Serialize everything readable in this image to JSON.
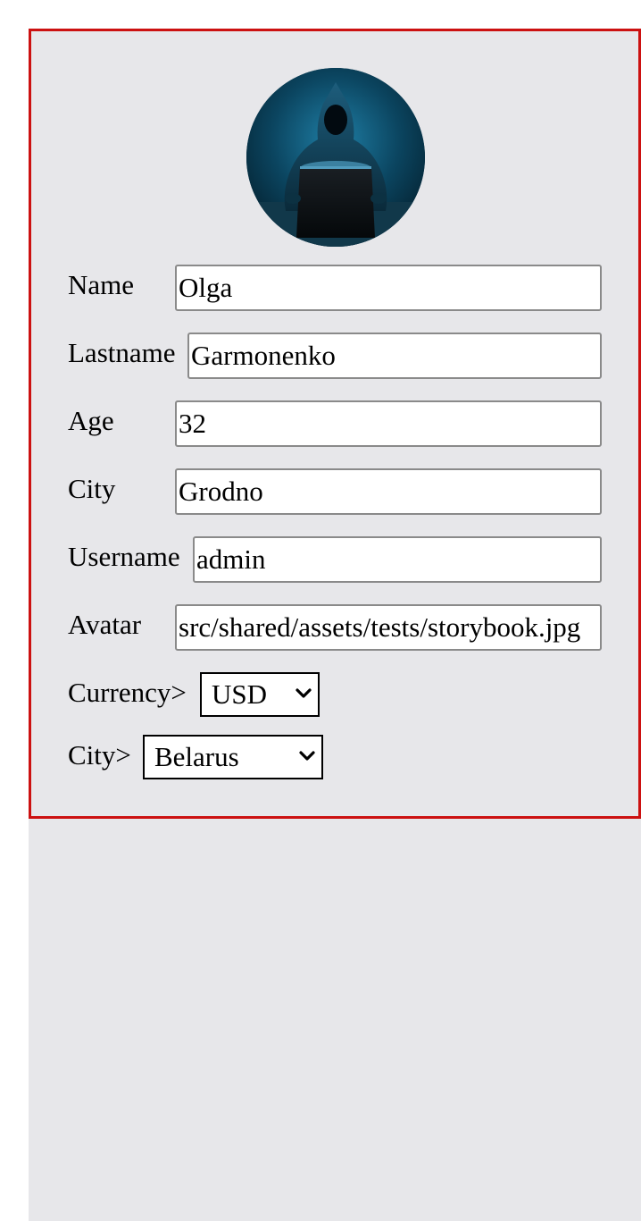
{
  "profile": {
    "avatar_alt": "hooded figure at laptop",
    "fields": [
      {
        "key": "name",
        "label": "Name",
        "value": "Olga"
      },
      {
        "key": "lastname",
        "label": "Lastname",
        "value": "Garmonenko"
      },
      {
        "key": "age",
        "label": "Age",
        "value": "32"
      },
      {
        "key": "city",
        "label": "City",
        "value": "Grodno"
      },
      {
        "key": "username",
        "label": "Username",
        "value": "admin"
      },
      {
        "key": "avatar",
        "label": "Avatar",
        "value": "src/shared/assets/tests/storybook.jpg"
      }
    ],
    "currency": {
      "label": "Currency>",
      "selected": "USD"
    },
    "country": {
      "label": "City>",
      "selected": "Belarus"
    }
  },
  "colors": {
    "card_border": "#cc1111",
    "background": "#e7e7ea"
  }
}
